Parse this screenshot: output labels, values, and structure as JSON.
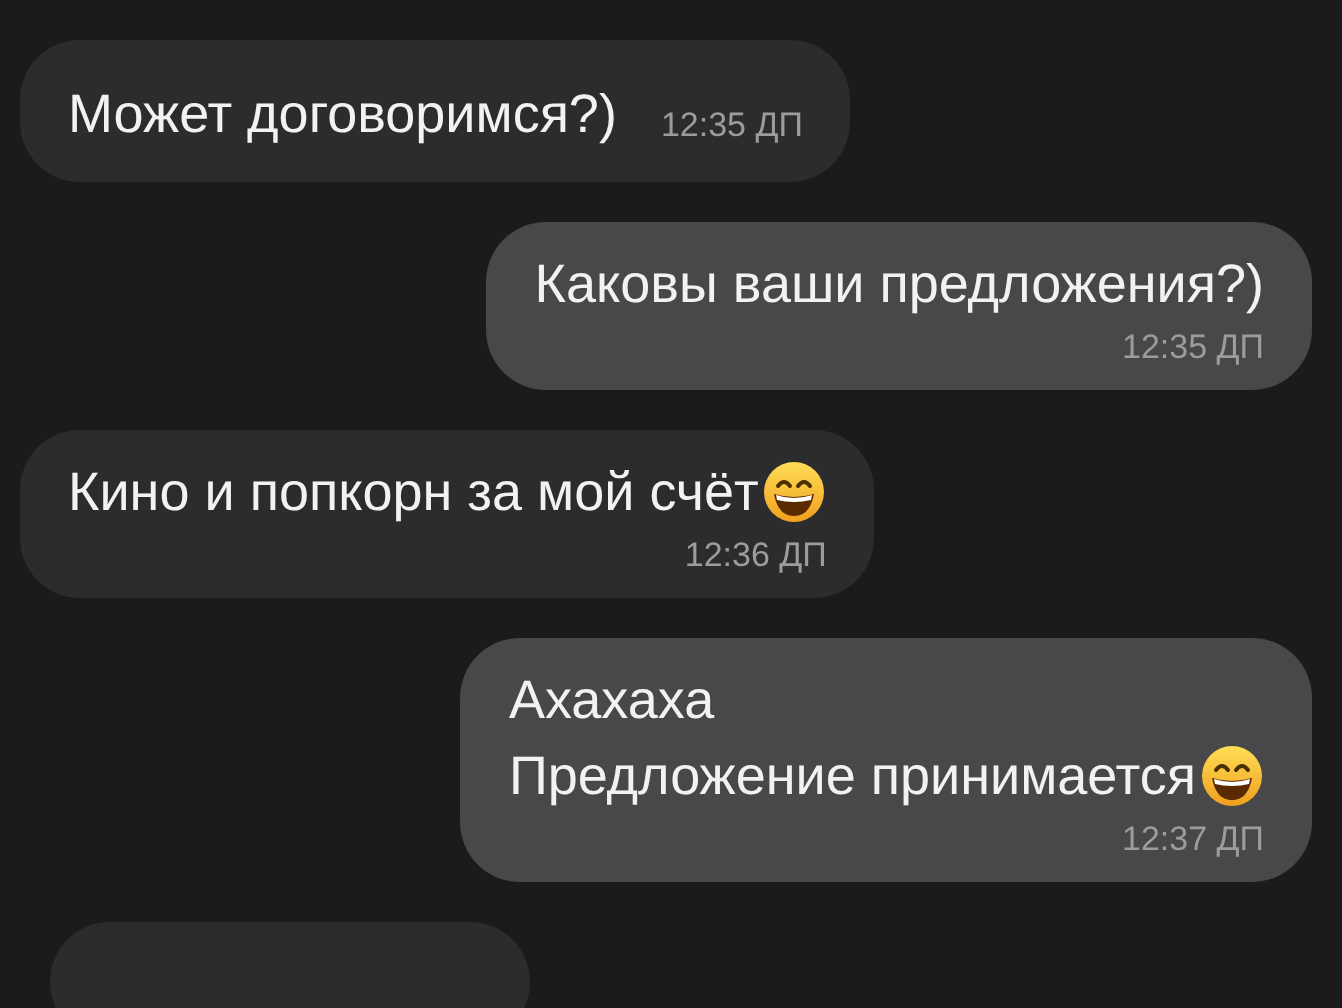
{
  "messages": [
    {
      "outgoing": false,
      "kind": "inline",
      "lines": [
        {
          "text": "Может договоримся?)",
          "emoji": false
        }
      ],
      "time": "12:35 ДП"
    },
    {
      "outgoing": true,
      "kind": "stacked",
      "lines": [
        {
          "text": "Каковы ваши предложения?)",
          "emoji": false
        }
      ],
      "time": "12:35 ДП"
    },
    {
      "outgoing": false,
      "kind": "stacked",
      "lines": [
        {
          "text": "Кино и попкорн за мой счёт",
          "emoji": true
        }
      ],
      "time": "12:36 ДП"
    },
    {
      "outgoing": true,
      "kind": "stacked",
      "lines": [
        {
          "text": "Ахахаха",
          "emoji": false
        },
        {
          "text": "Предложение принимается ",
          "emoji": true
        }
      ],
      "time": "12:37 ДП"
    }
  ],
  "partial_bubble_below": true
}
